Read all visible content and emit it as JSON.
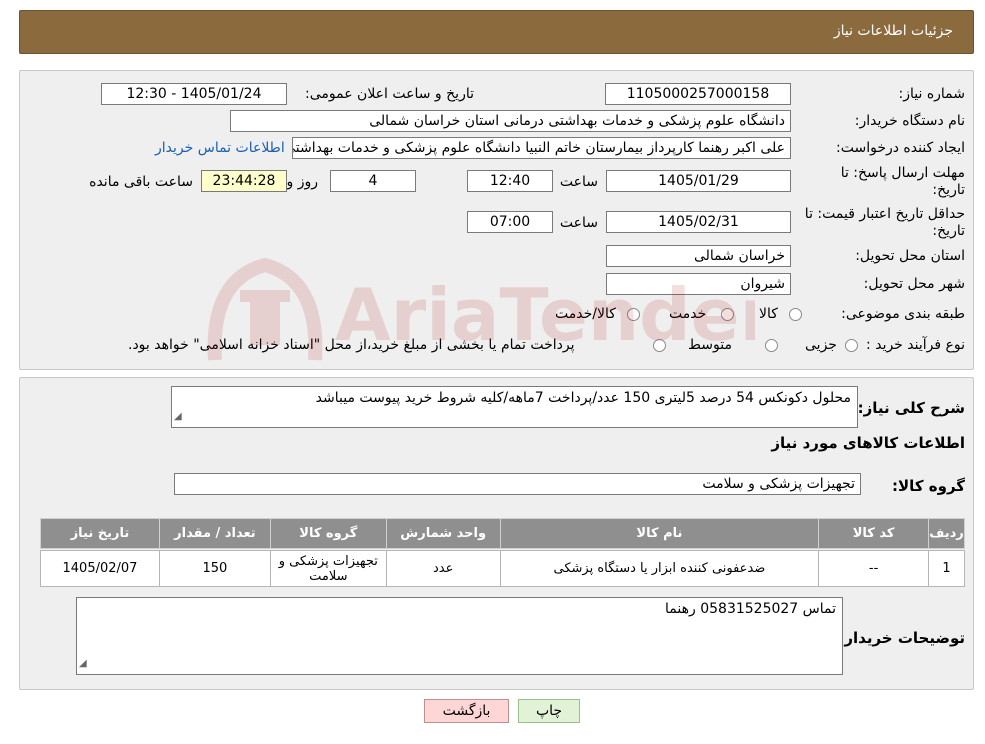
{
  "header": {
    "title": "جزئیات اطلاعات نیاز"
  },
  "need": {
    "number_label": "شماره نیاز:",
    "number_value": "1105000257000158",
    "announce_label": "تاریخ و ساعت اعلان عمومی:",
    "announce_value": "1405/01/24 - 12:30",
    "buyer_label": "نام دستگاه خریدار:",
    "buyer_value": "دانشگاه علوم پزشکی و خدمات بهداشتی درمانی استان خراسان شمالی",
    "creator_label": "ایجاد کننده درخواست:",
    "creator_value": "علی اکبر رهنما کارپرداز بیمارستان خاتم النبیا دانشگاه علوم پزشکی و خدمات بهداشتی",
    "contact_link": "اطلاعات تماس خریدار",
    "deadline_label": "مهلت ارسال پاسخ: تا تاریخ:",
    "deadline_date": "1405/01/29",
    "time_label": "ساعت",
    "deadline_time": "12:40",
    "days_value": "4",
    "days_label": "روز و",
    "remaining_value": "23:44:28",
    "remaining_label": "ساعت باقی مانده",
    "validity_label": "حداقل تاریخ اعتبار قیمت: تا تاریخ:",
    "validity_date": "1405/02/31",
    "validity_time": "07:00",
    "province_label": "استان محل تحویل:",
    "province_value": "خراسان شمالی",
    "city_label": "شهر محل تحویل:",
    "city_value": "شیروان",
    "category_label": "طبقه بندی موضوعی:",
    "category_options": [
      "کالا",
      "خدمت",
      "کالا/خدمت"
    ],
    "process_label": "نوع فرآیند خرید :",
    "process_options": [
      "جزیی",
      "متوسط"
    ],
    "process_note": "پرداخت تمام یا بخشی از مبلغ خرید،از محل \"اسناد خزانه اسلامی\" خواهد بود."
  },
  "details": {
    "desc_label": "شرح کلی نیاز:",
    "desc_value": "محلول دکونکس 54 درصد 5لیتری 150 عدد/پرداخت 7ماهه/کلیه شروط خرید پیوست میباشد",
    "goods_title": "اطلاعات کالاهای مورد نیاز",
    "group_label": "گروه کالا:",
    "group_value": "تجهیزات پزشکی و سلامت",
    "table": {
      "headers": [
        "ردیف",
        "کد کالا",
        "نام کالا",
        "واحد شمارش",
        "گروه کالا",
        "تعداد / مقدار",
        "تاریخ نیاز"
      ],
      "rows": [
        [
          "1",
          "--",
          "ضدعفونی کننده ابزار یا دستگاه پزشکی",
          "عدد",
          "تجهیزات پزشکی و سلامت",
          "150",
          "1405/02/07"
        ]
      ]
    },
    "buyer_notes_label": "توضیحات خریدار:",
    "buyer_notes_value": "تماس 05831525027 رهنما"
  },
  "buttons": {
    "back": "بازگشت",
    "print": "چاپ"
  },
  "watermark": {
    "text": "AriaTender.neT"
  }
}
